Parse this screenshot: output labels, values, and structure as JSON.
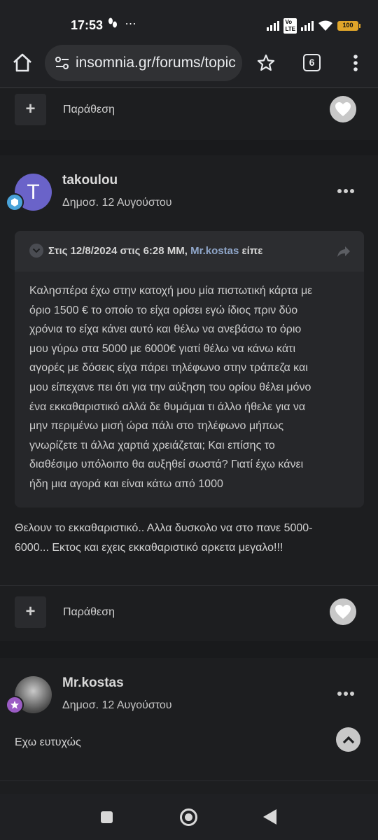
{
  "status_bar": {
    "time": "17:53",
    "left_icons": "⋯",
    "battery": "100"
  },
  "browser": {
    "url": "insomnia.gr/forums/topic",
    "tab_count": "6"
  },
  "footer_top": {
    "plus": "+",
    "quote_label": "Παράθεση"
  },
  "post1": {
    "avatar_letter": "T",
    "username": "takoulou",
    "date": "Δημοσ. 12 Αυγούστου",
    "quote": {
      "attribution": "Στις 12/8/2024 στις 6:28 ΜΜ, ",
      "author": "Mr.kostas",
      "said": " είπε",
      "lines": [
        "Καλησπέρα έχω στην κατοχή μου μία πιστωτική κάρτα με",
        "όριο 1500 € το οποίο το είχα ορίσει εγώ ίδιος πριν δύο",
        "χρόνια το είχα κάνει αυτό και θέλω να ανεβάσω το όριο",
        "μου γύρω στα 5000 με 6000€ γιατί θέλω να κάνω κάτι",
        "αγορές με δόσεις είχα πάρει τηλέφωνο στην τράπεζα και",
        "μου είπεχανε πει ότι για την αύξηση του ορίου θέλει μόνο",
        "ένα εκκαθαριστικό αλλά δε θυμάμαι τι άλλο ήθελε για να",
        "μην περιμένω μισή ώρα πάλι στο τηλέφωνο μήπως",
        "γνωρίζετε τι άλλα χαρτιά χρειάζεται; Και επίσης το",
        "διαθέσιμο υπόλοιπο θα αυξηθεί σωστά? Γιατί έχω κάνει",
        "ήδη μια αγορά και είναι κάτω από 1000"
      ]
    },
    "text_lines": [
      "Θελουν  το εκκαθαριστικό.. Αλλα δυσκολο να στο πανε 5000-",
      "6000... Εκτος και εχεις εκκαθαριστικό αρκετα  μεγαλο!!!"
    ],
    "footer": {
      "plus": "+",
      "quote_label": "Παράθεση"
    }
  },
  "post2": {
    "username": "Mr.kostas",
    "date": "Δημοσ. 12 Αυγούστου",
    "text": "Εχω ευτυχώς"
  },
  "colors": {
    "background": "#1d1e20",
    "avatar_t": "#6a63c9",
    "quote_author": "#8fa6c9",
    "badge_blue": "#4aa3d9",
    "badge_purple": "#9b5cc4"
  }
}
